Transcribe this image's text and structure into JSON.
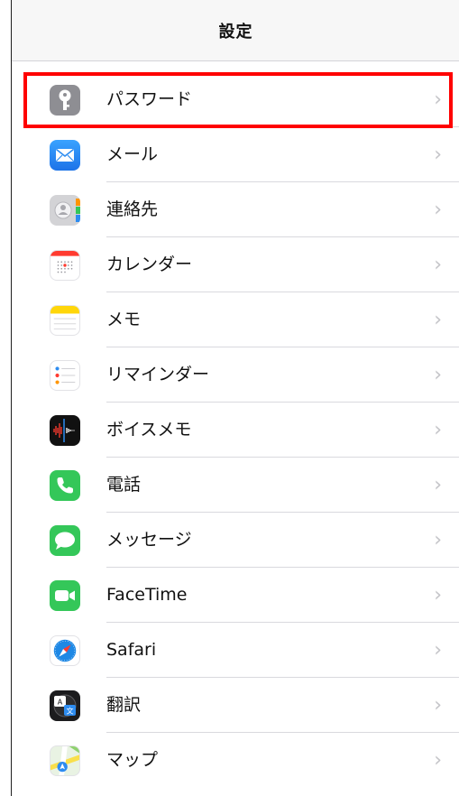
{
  "header": {
    "title": "設定"
  },
  "colors": {
    "highlight": "#ff0000"
  },
  "items": [
    {
      "label": "パスワード",
      "icon": "key-icon",
      "color": "#8e8e93"
    },
    {
      "label": "メール",
      "icon": "mail-icon",
      "color": "#2d8cf0"
    },
    {
      "label": "連絡先",
      "icon": "contacts-icon",
      "color": "#cfcfd2"
    },
    {
      "label": "カレンダー",
      "icon": "calendar-icon",
      "color": "#ffffff"
    },
    {
      "label": "メモ",
      "icon": "notes-icon",
      "color": "#ffffff"
    },
    {
      "label": "リマインダー",
      "icon": "reminders-icon",
      "color": "#ffffff"
    },
    {
      "label": "ボイスメモ",
      "icon": "voice-memos-icon",
      "color": "#111111"
    },
    {
      "label": "電話",
      "icon": "phone-icon",
      "color": "#34c759"
    },
    {
      "label": "メッセージ",
      "icon": "messages-icon",
      "color": "#34c759"
    },
    {
      "label": "FaceTime",
      "icon": "facetime-icon",
      "color": "#34c759"
    },
    {
      "label": "Safari",
      "icon": "safari-icon",
      "color": "#ffffff"
    },
    {
      "label": "翻訳",
      "icon": "translate-icon",
      "color": "#1c1c1e"
    },
    {
      "label": "マップ",
      "icon": "maps-icon",
      "color": "#e9f3e3"
    }
  ],
  "chevron": "›"
}
